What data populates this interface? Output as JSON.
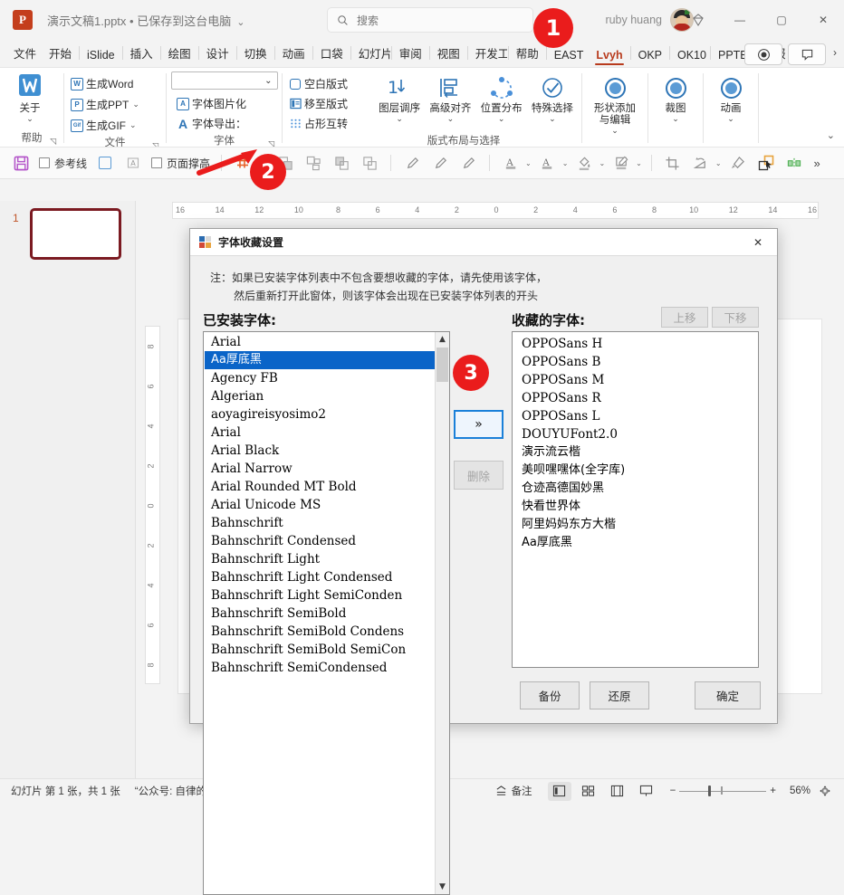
{
  "titlebar": {
    "app_icon": "powerpoint-icon",
    "document_title": "演示文稿1.pptx • 已保存到这台电脑",
    "title_chevron": "⌄",
    "search_placeholder": "搜索",
    "account_name": "ruby huang",
    "minimize": "—",
    "maximize": "▢",
    "close": "✕"
  },
  "tabs": [
    {
      "label": "文件"
    },
    {
      "label": "开始"
    },
    {
      "label": "iSlide"
    },
    {
      "label": "插入"
    },
    {
      "label": "绘图"
    },
    {
      "label": "设计"
    },
    {
      "label": "切换"
    },
    {
      "label": "动画"
    },
    {
      "label": "口袋"
    },
    {
      "label": "幻灯片"
    },
    {
      "label": "审阅"
    },
    {
      "label": "视图"
    },
    {
      "label": "开发工具"
    },
    {
      "label": "帮助"
    },
    {
      "label": "EAST"
    },
    {
      "label": "Lvyh",
      "active": true
    },
    {
      "label": "OKP"
    },
    {
      "label": "OK10"
    },
    {
      "label": "PPTB"
    },
    {
      "label": "简报"
    }
  ],
  "tab_overflow": "›",
  "ribbon": {
    "groups": [
      {
        "label": "帮助",
        "has_launcher": true,
        "big_buttons": [
          {
            "label": "关于",
            "caret": "⌄",
            "icon": "islide-logo-icon"
          }
        ]
      },
      {
        "label": "文件",
        "has_launcher": true,
        "items": [
          {
            "label": "生成Word",
            "icon": "word-icon",
            "badge": "W"
          },
          {
            "label": "生成PPT",
            "icon": "ppt-icon",
            "badge": "P",
            "caret": "⌄"
          },
          {
            "label": "生成GIF",
            "icon": "gif-icon",
            "badge": "Gif",
            "caret": "⌄"
          }
        ]
      },
      {
        "label": "字体",
        "has_launcher": true,
        "combo_value": "",
        "combo_caret": "⌄",
        "items": [
          {
            "label": "字体图片化",
            "icon": "text-image-icon",
            "badge": "A"
          },
          {
            "label": "字体导出：",
            "icon": "font-export-icon",
            "badge": "A"
          }
        ]
      },
      {
        "label": "版式布局与选择",
        "items": [
          {
            "label": "空白版式",
            "icon": "blank-layout-icon"
          },
          {
            "label": "移至版式",
            "icon": "move-layout-icon"
          },
          {
            "label": "占形互转",
            "icon": "placeholder-swap-icon"
          }
        ],
        "big_buttons": [
          {
            "label": "图层调序",
            "caret": "⌄",
            "icon": "layer-order-icon"
          },
          {
            "label": "高级对齐",
            "caret": "⌄",
            "icon": "advanced-align-icon"
          },
          {
            "label": "位置分布",
            "caret": "⌄",
            "icon": "position-distribute-icon"
          },
          {
            "label": "特殊选择",
            "caret": "⌄",
            "icon": "special-select-icon"
          }
        ]
      },
      {
        "label": "",
        "big_buttons": [
          {
            "label": "形状添加\n与编辑",
            "caret": "⌄",
            "icon": "shape-add-icon"
          },
          {
            "label": "裁图",
            "caret": "⌄",
            "icon": "crop-image-icon"
          },
          {
            "label": "动画",
            "caret": "⌄",
            "icon": "animation-icon"
          }
        ]
      }
    ],
    "collapse_caret": "⌄"
  },
  "quickbar": {
    "save_icon": "save-icon",
    "guides_label": "参考线",
    "page_height_label": "页面撑高",
    "more": "»",
    "icons": [
      "select-frame-icon",
      "text-frame-icon",
      "grid-icon",
      "group-icon",
      "ungroup-icon",
      "bring-front-icon",
      "send-back-icon",
      "eyedropper-1-icon",
      "eyedropper-2-icon",
      "eyedropper-3-icon",
      "font-color-icon",
      "text-outline-icon",
      "fill-color-icon",
      "shape-edit-icon",
      "crop-icon",
      "rotate-icon",
      "format-painter-icon",
      "select-object-icon",
      "align-icon"
    ]
  },
  "workspace": {
    "thumbnail_number": "1",
    "h_ruler_ticks": [
      "16",
      "14",
      "12",
      "10",
      "8",
      "6",
      "4",
      "2",
      "0",
      "2",
      "4",
      "6",
      "8",
      "10",
      "12",
      "14",
      "16"
    ],
    "v_ruler_ticks": [
      "8",
      "6",
      "4",
      "2",
      "0",
      "2",
      "4",
      "6",
      "8"
    ]
  },
  "statusbar": {
    "slide_info": "幻灯片 第 1 张，共 1 张",
    "quote": "“公众号: 自律的音律”",
    "notes_label": "备注",
    "view_buttons": [
      "normal-view-icon",
      "slide-sorter-icon",
      "reading-view-icon",
      "slideshow-icon"
    ],
    "zoom_out": "−",
    "zoom_in": "+",
    "zoom_level": "56%",
    "fit_icon": "fit-to-window-icon"
  },
  "dialog": {
    "title": "字体收藏设置",
    "title_icon": "settings-window-icon",
    "close_label": "✕",
    "note_line1": "注：如果已安装字体列表中不包含要想收藏的字体，请先使用该字体，",
    "note_line2": "然后重新打开此窗体，则该字体会出现在已安装字体列表的开头",
    "installed_heading": "已安装字体:",
    "favorites_heading": "收藏的字体:",
    "move_up_label": "上移",
    "move_down_label": "下移",
    "add_label": "»",
    "delete_label": "删除",
    "backup_label": "备份",
    "restore_label": "还原",
    "ok_label": "确定",
    "installed_fonts": [
      {
        "name": "Arial",
        "selected": false
      },
      {
        "name": "Aa厚底黑",
        "selected": true,
        "cjk": true
      },
      {
        "name": "Agency FB",
        "selected": false
      },
      {
        "name": "Algerian",
        "selected": false
      },
      {
        "name": "aoyagireisyosimo2",
        "selected": false
      },
      {
        "name": "Arial",
        "selected": false
      },
      {
        "name": "Arial Black",
        "selected": false
      },
      {
        "name": "Arial Narrow",
        "selected": false
      },
      {
        "name": "Arial Rounded MT Bold",
        "selected": false
      },
      {
        "name": "Arial Unicode MS",
        "selected": false
      },
      {
        "name": "Bahnschrift",
        "selected": false
      },
      {
        "name": "Bahnschrift Condensed",
        "selected": false
      },
      {
        "name": "Bahnschrift Light",
        "selected": false
      },
      {
        "name": "Bahnschrift Light Condensed",
        "selected": false
      },
      {
        "name": "Bahnschrift Light SemiConden",
        "selected": false
      },
      {
        "name": "Bahnschrift SemiBold",
        "selected": false
      },
      {
        "name": "Bahnschrift SemiBold Condens",
        "selected": false
      },
      {
        "name": "Bahnschrift SemiBold SemiCon",
        "selected": false
      },
      {
        "name": "Bahnschrift SemiCondensed",
        "selected": false
      }
    ],
    "favorite_fonts": [
      {
        "name": "OPPOSans H",
        "cjk": false
      },
      {
        "name": "OPPOSans B",
        "cjk": false
      },
      {
        "name": "OPPOSans M",
        "cjk": false
      },
      {
        "name": "OPPOSans R",
        "cjk": false
      },
      {
        "name": "OPPOSans L",
        "cjk": false
      },
      {
        "name": "DOUYUFont2.0",
        "cjk": false
      },
      {
        "name": "演示流云楷",
        "cjk": true
      },
      {
        "name": "美呗嘿嘿体(全字库)",
        "cjk": true
      },
      {
        "name": "仓迹高德国妙黑",
        "cjk": true
      },
      {
        "name": "快看世界体",
        "cjk": true
      },
      {
        "name": "阿里妈妈东方大楷",
        "cjk": true
      },
      {
        "name": "Aa厚底黑",
        "cjk": true
      }
    ]
  },
  "annotations": {
    "badge1": "1",
    "badge2": "2",
    "badge3": "3",
    "accent_color": "#ea1c1c"
  }
}
